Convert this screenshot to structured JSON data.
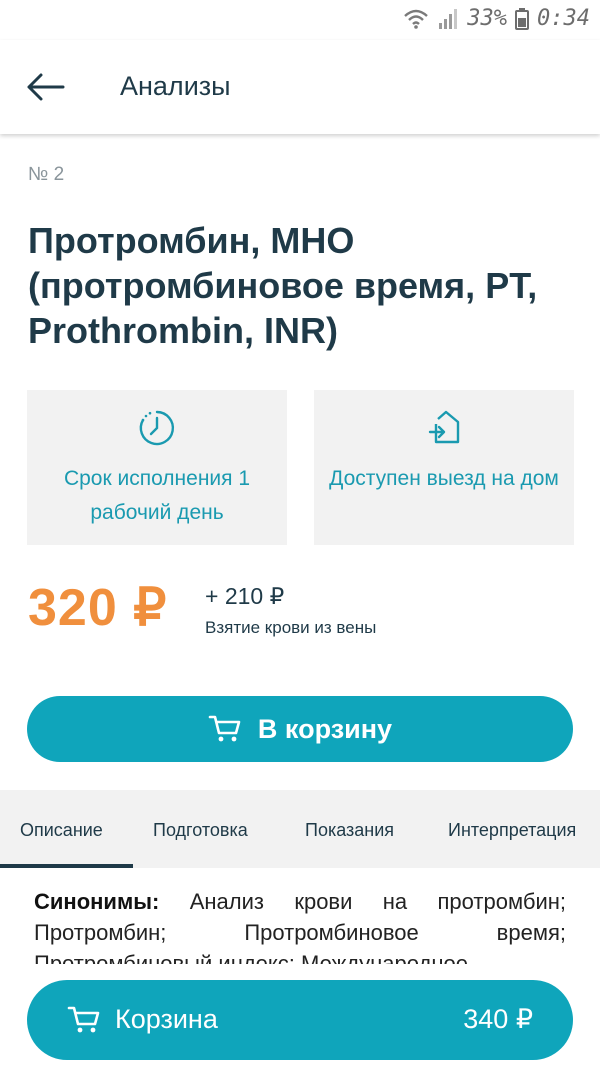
{
  "status_bar": {
    "battery": "33%",
    "time": "0:34"
  },
  "header": {
    "title": "Анализы",
    "back_icon": "arrow-left-icon"
  },
  "test": {
    "number": "№ 2",
    "title": "Протромбин, МНО (протромбиновое время, PT, Prothrombin, INR)"
  },
  "info_cards": [
    {
      "icon": "clock-icon",
      "text": "Срок исполнения 1 рабочий день"
    },
    {
      "icon": "home-arrow-icon",
      "text": "Доступен выезд на дом"
    }
  ],
  "price": {
    "main": "320 ₽",
    "extra": "+ 210 ₽",
    "extra_label": "Взятие крови из вены"
  },
  "cart_button": {
    "label": "В корзину",
    "icon": "cart-icon"
  },
  "tabs": [
    {
      "label": "Описание",
      "active": true
    },
    {
      "label": "Подготовка"
    },
    {
      "label": "Показания"
    },
    {
      "label": "Интерпретация"
    }
  ],
  "description": {
    "bold": "Синонимы:",
    "text": " Анализ крови на протромбин; Протромбин; Протромбиновое время; Протромбиновый индекс; Международное"
  },
  "basket": {
    "label": "Корзина",
    "total": "340 ₽",
    "icon": "cart-icon"
  },
  "colors": {
    "accent": "#0fa5bb",
    "price": "#f08f3d",
    "text": "#1f3a48"
  }
}
